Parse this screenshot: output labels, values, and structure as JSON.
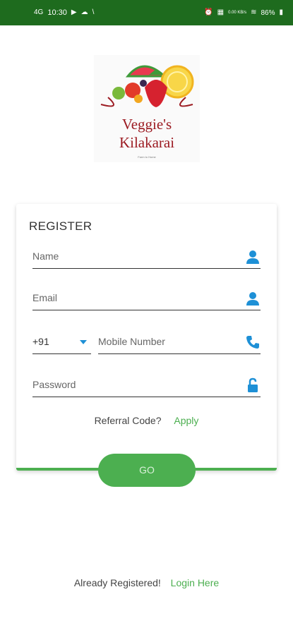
{
  "status_bar": {
    "network": "4G",
    "time": "10:30",
    "speed": "0.00 KB/s",
    "battery": "86%"
  },
  "logo": {
    "line1": "Veggie's",
    "line2": "Kilakarai",
    "tagline": "Farm to Home"
  },
  "register": {
    "title": "REGISTER",
    "name_placeholder": "Name",
    "email_placeholder": "Email",
    "country_code": "+91",
    "mobile_placeholder": "Mobile Number",
    "password_placeholder": "Password",
    "referral_label": "Referral Code?",
    "referral_link": "Apply",
    "go_label": "GO"
  },
  "footer": {
    "already_label": "Already Registered!",
    "login_link": "Login Here"
  },
  "colors": {
    "accent_green": "#4caf50",
    "status_bar": "#1e6b1e",
    "icon_blue": "#1e90d6"
  }
}
